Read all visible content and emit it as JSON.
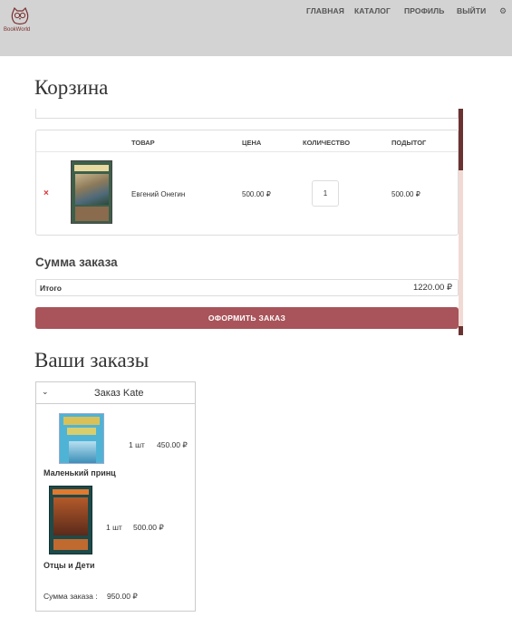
{
  "header": {
    "logo_text": "BookWorld",
    "nav": [
      "ГЛАВНАЯ",
      "КАТАЛОГ",
      "ПРОФИЛЬ",
      "ВЫЙТИ"
    ],
    "gear_icon": "gear-icon"
  },
  "cart": {
    "title": "Корзина",
    "columns": [
      "ТОВАР",
      "ЦЕНА",
      "КОЛИЧЕСТВО",
      "ПОДЫТОГ"
    ],
    "items": [
      {
        "name": "Евгений Онегин",
        "price": "500.00 ₽",
        "quantity": "1",
        "subtotal": "500.00 ₽"
      }
    ],
    "summary_title": "Сумма заказа",
    "total_label": "Итого",
    "total_value": "1220.00 ₽",
    "checkout_label": "ОФОРМИТЬ ЗАКАЗ",
    "remove_symbol": "×"
  },
  "orders": {
    "title": "Ваши заказы",
    "order": {
      "title": "Заказ Kate",
      "items": [
        {
          "name": "Маленький принц",
          "qty": "1 шт",
          "price": "450.00 ₽"
        },
        {
          "name": "Отцы и Дети",
          "qty": "1 шт",
          "price": "500.00 ₽"
        }
      ],
      "sum_label": "Сумма заказа :",
      "sum_value": "950.00 ₽"
    }
  },
  "colors": {
    "header_bg": "#d3d3d3",
    "accent": "#a8545a",
    "scrollbar_thumb": "#6b3232",
    "remove": "#dd3333"
  }
}
